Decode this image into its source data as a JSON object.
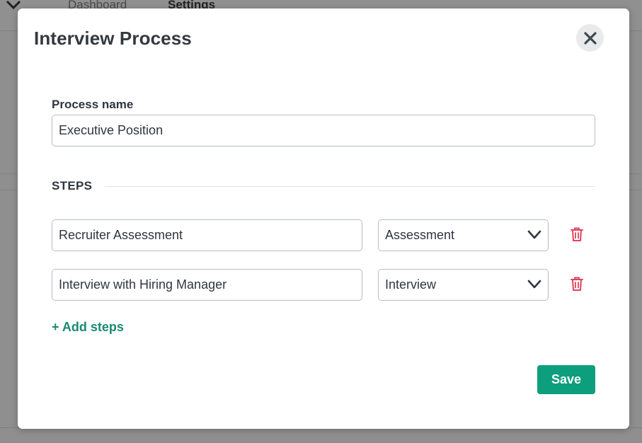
{
  "background": {
    "tabs": [
      "Dashboard",
      "Settings"
    ]
  },
  "modal": {
    "title": "Interview Process",
    "close_icon": "close-icon",
    "process_name": {
      "label": "Process name",
      "value": "Executive Position"
    },
    "steps_heading": "STEPS",
    "steps": [
      {
        "name": "Recruiter Assessment",
        "type": "Assessment"
      },
      {
        "name": "Interview with Hiring Manager",
        "type": "Interview"
      }
    ],
    "add_steps_label": "+ Add steps",
    "save_label": "Save"
  },
  "colors": {
    "accent": "#0d9e7d",
    "link": "#1b8a70",
    "delete": "#e0435b",
    "overlay": "#8f8f8f"
  }
}
